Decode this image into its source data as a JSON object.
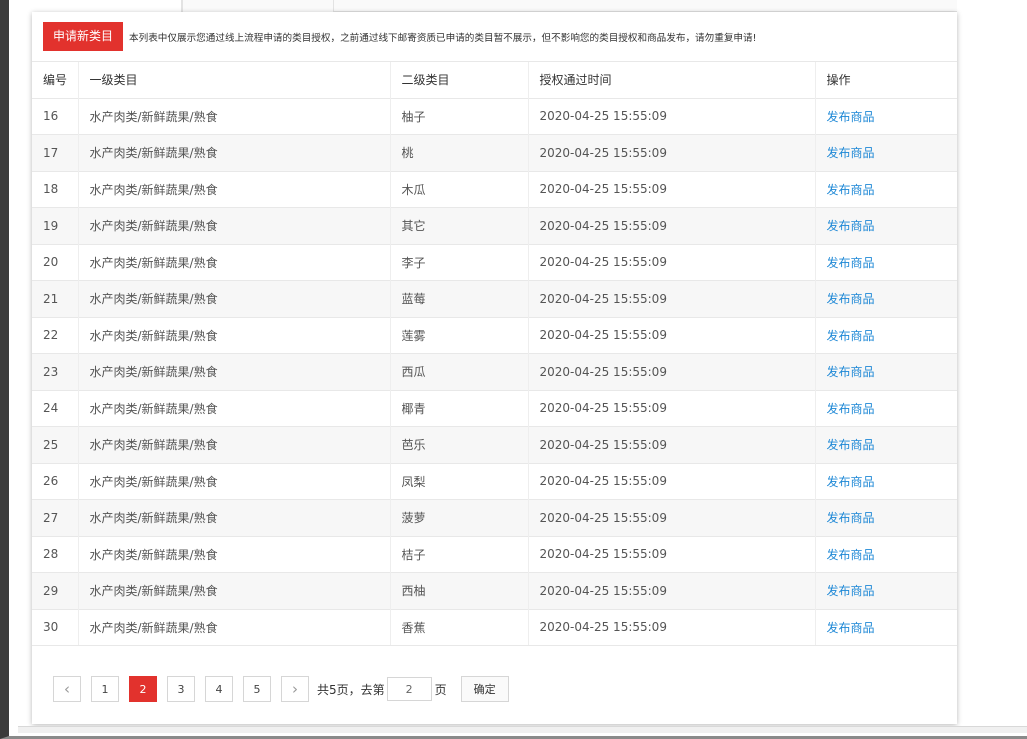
{
  "apply_button": "申请新类目",
  "notice": "本列表中仅展示您通过线上流程申请的类目授权，之前通过线下邮寄资质已申请的类目暂不展示，但不影响您的类目授权和商品发布，请勿重复申请!",
  "table": {
    "headers": [
      "编号",
      "一级类目",
      "二级类目",
      "授权通过时间",
      "操作"
    ],
    "rows": [
      {
        "id": "16",
        "cat1": "水产肉类/新鲜蔬果/熟食",
        "cat2": "柚子",
        "time": "2020-04-25 15:55:09",
        "action": "发布商品"
      },
      {
        "id": "17",
        "cat1": "水产肉类/新鲜蔬果/熟食",
        "cat2": "桃",
        "time": "2020-04-25 15:55:09",
        "action": "发布商品"
      },
      {
        "id": "18",
        "cat1": "水产肉类/新鲜蔬果/熟食",
        "cat2": "木瓜",
        "time": "2020-04-25 15:55:09",
        "action": "发布商品"
      },
      {
        "id": "19",
        "cat1": "水产肉类/新鲜蔬果/熟食",
        "cat2": "其它",
        "time": "2020-04-25 15:55:09",
        "action": "发布商品"
      },
      {
        "id": "20",
        "cat1": "水产肉类/新鲜蔬果/熟食",
        "cat2": "李子",
        "time": "2020-04-25 15:55:09",
        "action": "发布商品"
      },
      {
        "id": "21",
        "cat1": "水产肉类/新鲜蔬果/熟食",
        "cat2": "蓝莓",
        "time": "2020-04-25 15:55:09",
        "action": "发布商品"
      },
      {
        "id": "22",
        "cat1": "水产肉类/新鲜蔬果/熟食",
        "cat2": "莲雾",
        "time": "2020-04-25 15:55:09",
        "action": "发布商品"
      },
      {
        "id": "23",
        "cat1": "水产肉类/新鲜蔬果/熟食",
        "cat2": "西瓜",
        "time": "2020-04-25 15:55:09",
        "action": "发布商品"
      },
      {
        "id": "24",
        "cat1": "水产肉类/新鲜蔬果/熟食",
        "cat2": "椰青",
        "time": "2020-04-25 15:55:09",
        "action": "发布商品"
      },
      {
        "id": "25",
        "cat1": "水产肉类/新鲜蔬果/熟食",
        "cat2": "芭乐",
        "time": "2020-04-25 15:55:09",
        "action": "发布商品"
      },
      {
        "id": "26",
        "cat1": "水产肉类/新鲜蔬果/熟食",
        "cat2": "凤梨",
        "time": "2020-04-25 15:55:09",
        "action": "发布商品"
      },
      {
        "id": "27",
        "cat1": "水产肉类/新鲜蔬果/熟食",
        "cat2": "菠萝",
        "time": "2020-04-25 15:55:09",
        "action": "发布商品"
      },
      {
        "id": "28",
        "cat1": "水产肉类/新鲜蔬果/熟食",
        "cat2": "桔子",
        "time": "2020-04-25 15:55:09",
        "action": "发布商品"
      },
      {
        "id": "29",
        "cat1": "水产肉类/新鲜蔬果/熟食",
        "cat2": "西柚",
        "time": "2020-04-25 15:55:09",
        "action": "发布商品"
      },
      {
        "id": "30",
        "cat1": "水产肉类/新鲜蔬果/熟食",
        "cat2": "香蕉",
        "time": "2020-04-25 15:55:09",
        "action": "发布商品"
      }
    ]
  },
  "pagination": {
    "prev_icon": "‹",
    "next_icon": "›",
    "pages": [
      "1",
      "2",
      "3",
      "4",
      "5"
    ],
    "current": "2",
    "total_text": "共5页，去第",
    "goto_value": "2",
    "page_suffix": "页",
    "confirm": "确定"
  },
  "colors": {
    "accent": "#e2322d",
    "link": "#1e88d6"
  }
}
